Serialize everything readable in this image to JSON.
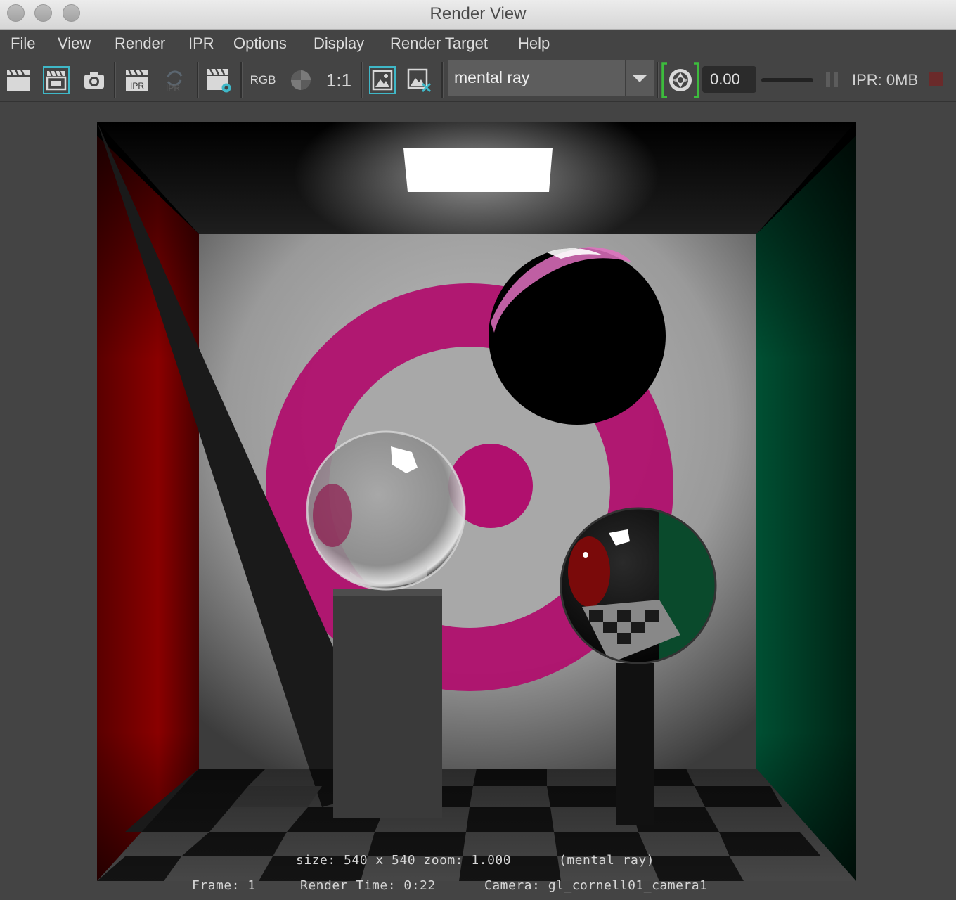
{
  "window": {
    "title": "Render View"
  },
  "menu": [
    "File",
    "View",
    "Render",
    "IPR",
    "Options",
    "Display",
    "Render Target",
    "Help"
  ],
  "toolbar": {
    "rgb_label": "RGB",
    "ratio_label": "1:1",
    "ipr_label": "IPR",
    "ipr_disabled_label": "IPR",
    "renderer": "mental ray",
    "exposure": "0.00",
    "ipr_memory": "IPR: 0MB"
  },
  "colors": {
    "accent_cyan": "#3fb8c8",
    "snapshot_green": "#3dbb3d",
    "wall_left": "#8a0000",
    "wall_right": "#003a22",
    "magenta": "#b0106e",
    "stop_red": "#6a2a2a"
  },
  "render": {
    "size_info": "size: 540 x 540 zoom: 1.000",
    "renderer_info": "(mental ray)",
    "frame": "Frame: 1",
    "render_time": "Render Time: 0:22",
    "camera": "Camera: gl_cornell01_camera1"
  }
}
